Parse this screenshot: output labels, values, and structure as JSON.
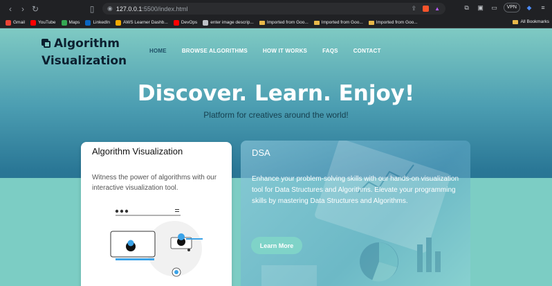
{
  "browser": {
    "url_host": "127.0.0.1",
    "url_rest": ":5500/index.html",
    "vpn_label": "VPN"
  },
  "bookmarks": [
    {
      "label": "Gmail",
      "color": "#ea4335"
    },
    {
      "label": "YouTube",
      "color": "#ff0000"
    },
    {
      "label": "Maps",
      "color": "#34a853"
    },
    {
      "label": "LinkedIn",
      "color": "#0a66c2"
    },
    {
      "label": "AWS Learner Dashb...",
      "color": "#f2a900"
    },
    {
      "label": "DevOps",
      "color": "#ff0000"
    },
    {
      "label": "enter image descrip...",
      "color": "#bdc1c6"
    },
    {
      "label": "Imported from Goo...",
      "color": "folder"
    },
    {
      "label": "Imported from Goo...",
      "color": "folder"
    },
    {
      "label": "Imported from Goo...",
      "color": "folder"
    }
  ],
  "all_bookmarks": "All Bookmarks",
  "site": {
    "logo_line1": "Algorithm",
    "logo_line2": "Visualization",
    "nav": [
      "HOME",
      "BROWSE ALGORITHMS",
      "HOW IT WORKS",
      "FAQS",
      "CONTACT"
    ],
    "hero_title": "Discover. Learn. Enjoy!",
    "hero_subtitle": "Platform for creatives around the world!",
    "card_left": {
      "title": "Algorithm Visualization",
      "text": "Witness the power of algorithms with our interactive visualization tool."
    },
    "card_right": {
      "title": "DSA",
      "text": "Enhance your problem-solving skills with our hands-on visualization tool for Data Structures and Algorithms. Elevate your programming skills by mastering Data Structures and Algorithms.",
      "button": "Learn More"
    }
  }
}
